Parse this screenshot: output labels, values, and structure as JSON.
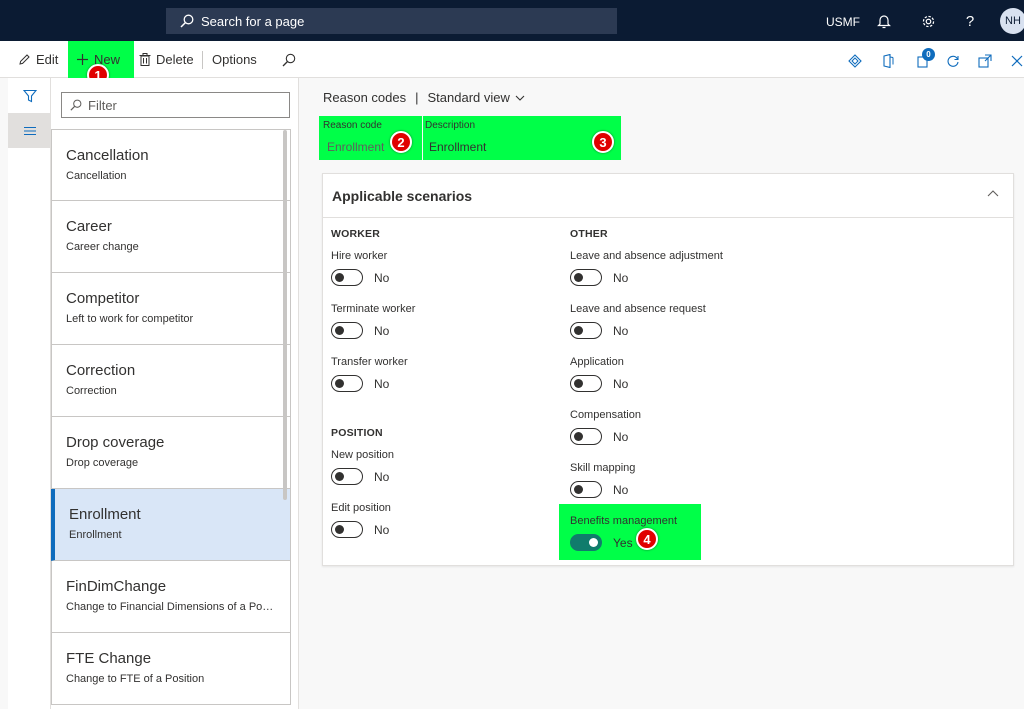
{
  "topbar": {
    "search_placeholder": "Search for a page",
    "company": "USMF",
    "user_initials": "NH",
    "help_glyph": "?"
  },
  "actions": {
    "edit": "Edit",
    "new": "New",
    "delete": "Delete",
    "options": "Options",
    "notification_count": "0"
  },
  "markers": [
    "1",
    "2",
    "3",
    "4"
  ],
  "list": {
    "filter_placeholder": "Filter",
    "items": [
      {
        "title": "Cancellation",
        "subtitle": "Cancellation"
      },
      {
        "title": "Career",
        "subtitle": "Career change"
      },
      {
        "title": "Competitor",
        "subtitle": "Left to work for competitor"
      },
      {
        "title": "Correction",
        "subtitle": "Correction"
      },
      {
        "title": "Drop coverage",
        "subtitle": "Drop coverage"
      },
      {
        "title": "Enrollment",
        "subtitle": "Enrollment"
      },
      {
        "title": "FinDimChange",
        "subtitle": "Change to Financial Dimensions of a Posi..."
      },
      {
        "title": "FTE Change",
        "subtitle": "Change to FTE of a Position"
      }
    ],
    "selected_index": 5
  },
  "details": {
    "breadcrumb_page": "Reason codes",
    "breadcrumb_sep": "|",
    "view": "Standard view",
    "reason_code_label": "Reason code",
    "reason_code_value": "Enrollment",
    "description_label": "Description",
    "description_value": "Enrollment"
  },
  "scenarios": {
    "title": "Applicable scenarios",
    "worker_heading": "WORKER",
    "other_heading": "OTHER",
    "position_heading": "POSITION",
    "worker": [
      {
        "label": "Hire worker",
        "value": "No",
        "on": false
      },
      {
        "label": "Terminate worker",
        "value": "No",
        "on": false
      },
      {
        "label": "Transfer worker",
        "value": "No",
        "on": false
      }
    ],
    "position": [
      {
        "label": "New position",
        "value": "No",
        "on": false
      },
      {
        "label": "Edit position",
        "value": "No",
        "on": false
      }
    ],
    "other": [
      {
        "label": "Leave and absence adjustment",
        "value": "No",
        "on": false
      },
      {
        "label": "Leave and absence request",
        "value": "No",
        "on": false
      },
      {
        "label": "Application",
        "value": "No",
        "on": false
      },
      {
        "label": "Compensation",
        "value": "No",
        "on": false
      },
      {
        "label": "Skill mapping",
        "value": "No",
        "on": false
      },
      {
        "label": "Benefits management",
        "value": "Yes",
        "on": true
      }
    ]
  },
  "colors": {
    "highlight": "#00ff48",
    "marker": "#e00000",
    "toggle_on": "#107c6c",
    "topbar": "#0b1b33",
    "selected_row": "#d9e6f7"
  }
}
